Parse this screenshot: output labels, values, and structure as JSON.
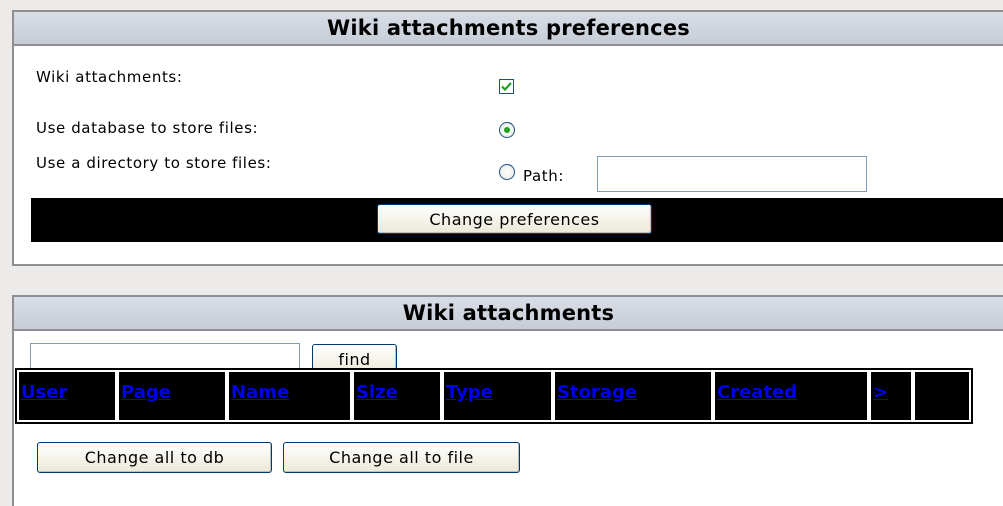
{
  "prefs": {
    "title": "Wiki attachments preferences",
    "wiki_attachments_label": "Wiki attachments:",
    "wiki_attachments_checked": true,
    "use_db_label": "Use database to store files:",
    "use_db_selected": true,
    "use_dir_label": "Use a directory to store files:",
    "use_dir_selected": false,
    "path_label": "Path:",
    "path_value": "",
    "submit_label": "Change preferences"
  },
  "attachments": {
    "title": "Wiki attachments",
    "find_value": "",
    "find_label": "find",
    "columns": [
      "User",
      "Page",
      "Name",
      "Size",
      "Type",
      "Storage",
      "Created",
      ">"
    ],
    "change_db_label": "Change all to db",
    "change_file_label": "Change all to file"
  },
  "colors": {
    "link": "#0000ee",
    "check": "#21a121",
    "header_bg": "#c7cdd7"
  }
}
